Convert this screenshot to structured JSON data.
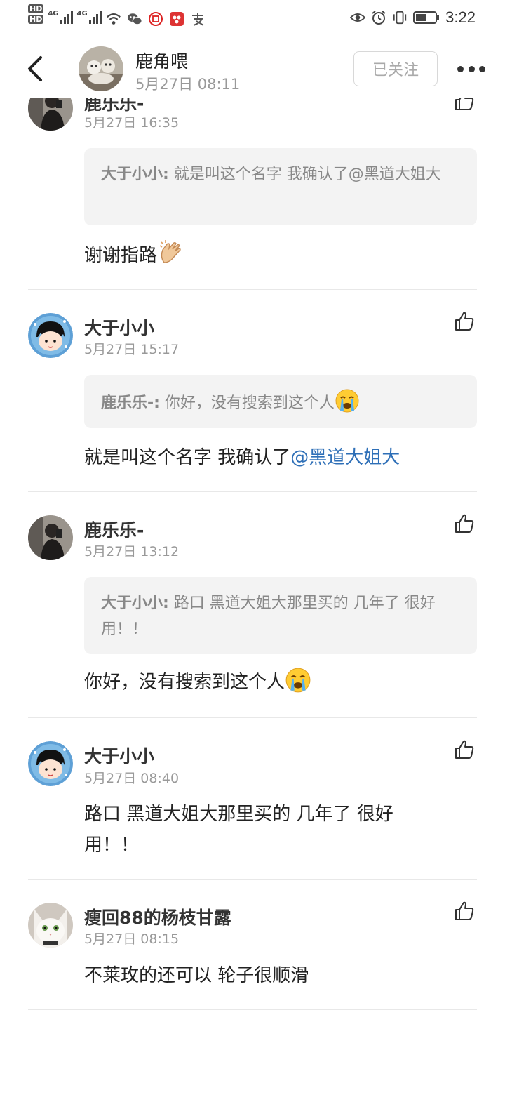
{
  "status_bar": {
    "hd1": "HD",
    "hd2": "HD",
    "sim1": "4G",
    "sim2": "4G",
    "time": "3:22"
  },
  "header": {
    "author_name": "鹿角喂",
    "author_time": "5月27日 08:11",
    "follow_label": "已关注"
  },
  "comments": [
    {
      "name": "鹿乐乐-",
      "time": "5月27日 16:35",
      "quote_author": "大于小小:",
      "quote_text": " 就是叫这个名字  我确认了@黑道大姐大",
      "body": "谢谢指路"
    },
    {
      "name": "大于小小",
      "time": "5月27日 15:17",
      "quote_author": "鹿乐乐-:",
      "quote_text": " 你好，没有搜索到这个人",
      "body": "就是叫这个名字  我确认了",
      "mention": "@黑道大姐大"
    },
    {
      "name": "鹿乐乐-",
      "time": "5月27日 13:12",
      "quote_author": "大于小小:",
      "quote_text": " 路口  黑道大姐大那里买的  几年了  很好用！！",
      "body": "你好，没有搜索到这个人"
    },
    {
      "name": "大于小小",
      "time": "5月27日 08:40",
      "body": "路口  黑道大姐大那里买的  几年了  很好用！！"
    },
    {
      "name": "瘦回88的杨枝甘露",
      "time": "5月27日 08:15",
      "body": "不莱玫的还可以 轮子很顺滑"
    }
  ]
}
